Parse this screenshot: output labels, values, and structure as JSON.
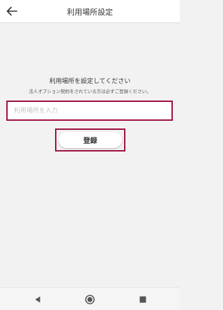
{
  "header": {
    "title": "利用場所設定",
    "back_icon": "arrow-left-icon"
  },
  "main": {
    "heading": "利用場所を設定してください",
    "subtext": "法人オプション契約をされている方は必ずご登録ください。",
    "input": {
      "value": "",
      "placeholder": "利用場所を入力"
    },
    "register_label": "登録"
  },
  "navbar": {
    "icons": [
      "triangle-back-icon",
      "circle-home-icon",
      "square-recent-icon"
    ]
  },
  "colors": {
    "highlight": "#a0123f",
    "background": "#f2f2f2"
  }
}
